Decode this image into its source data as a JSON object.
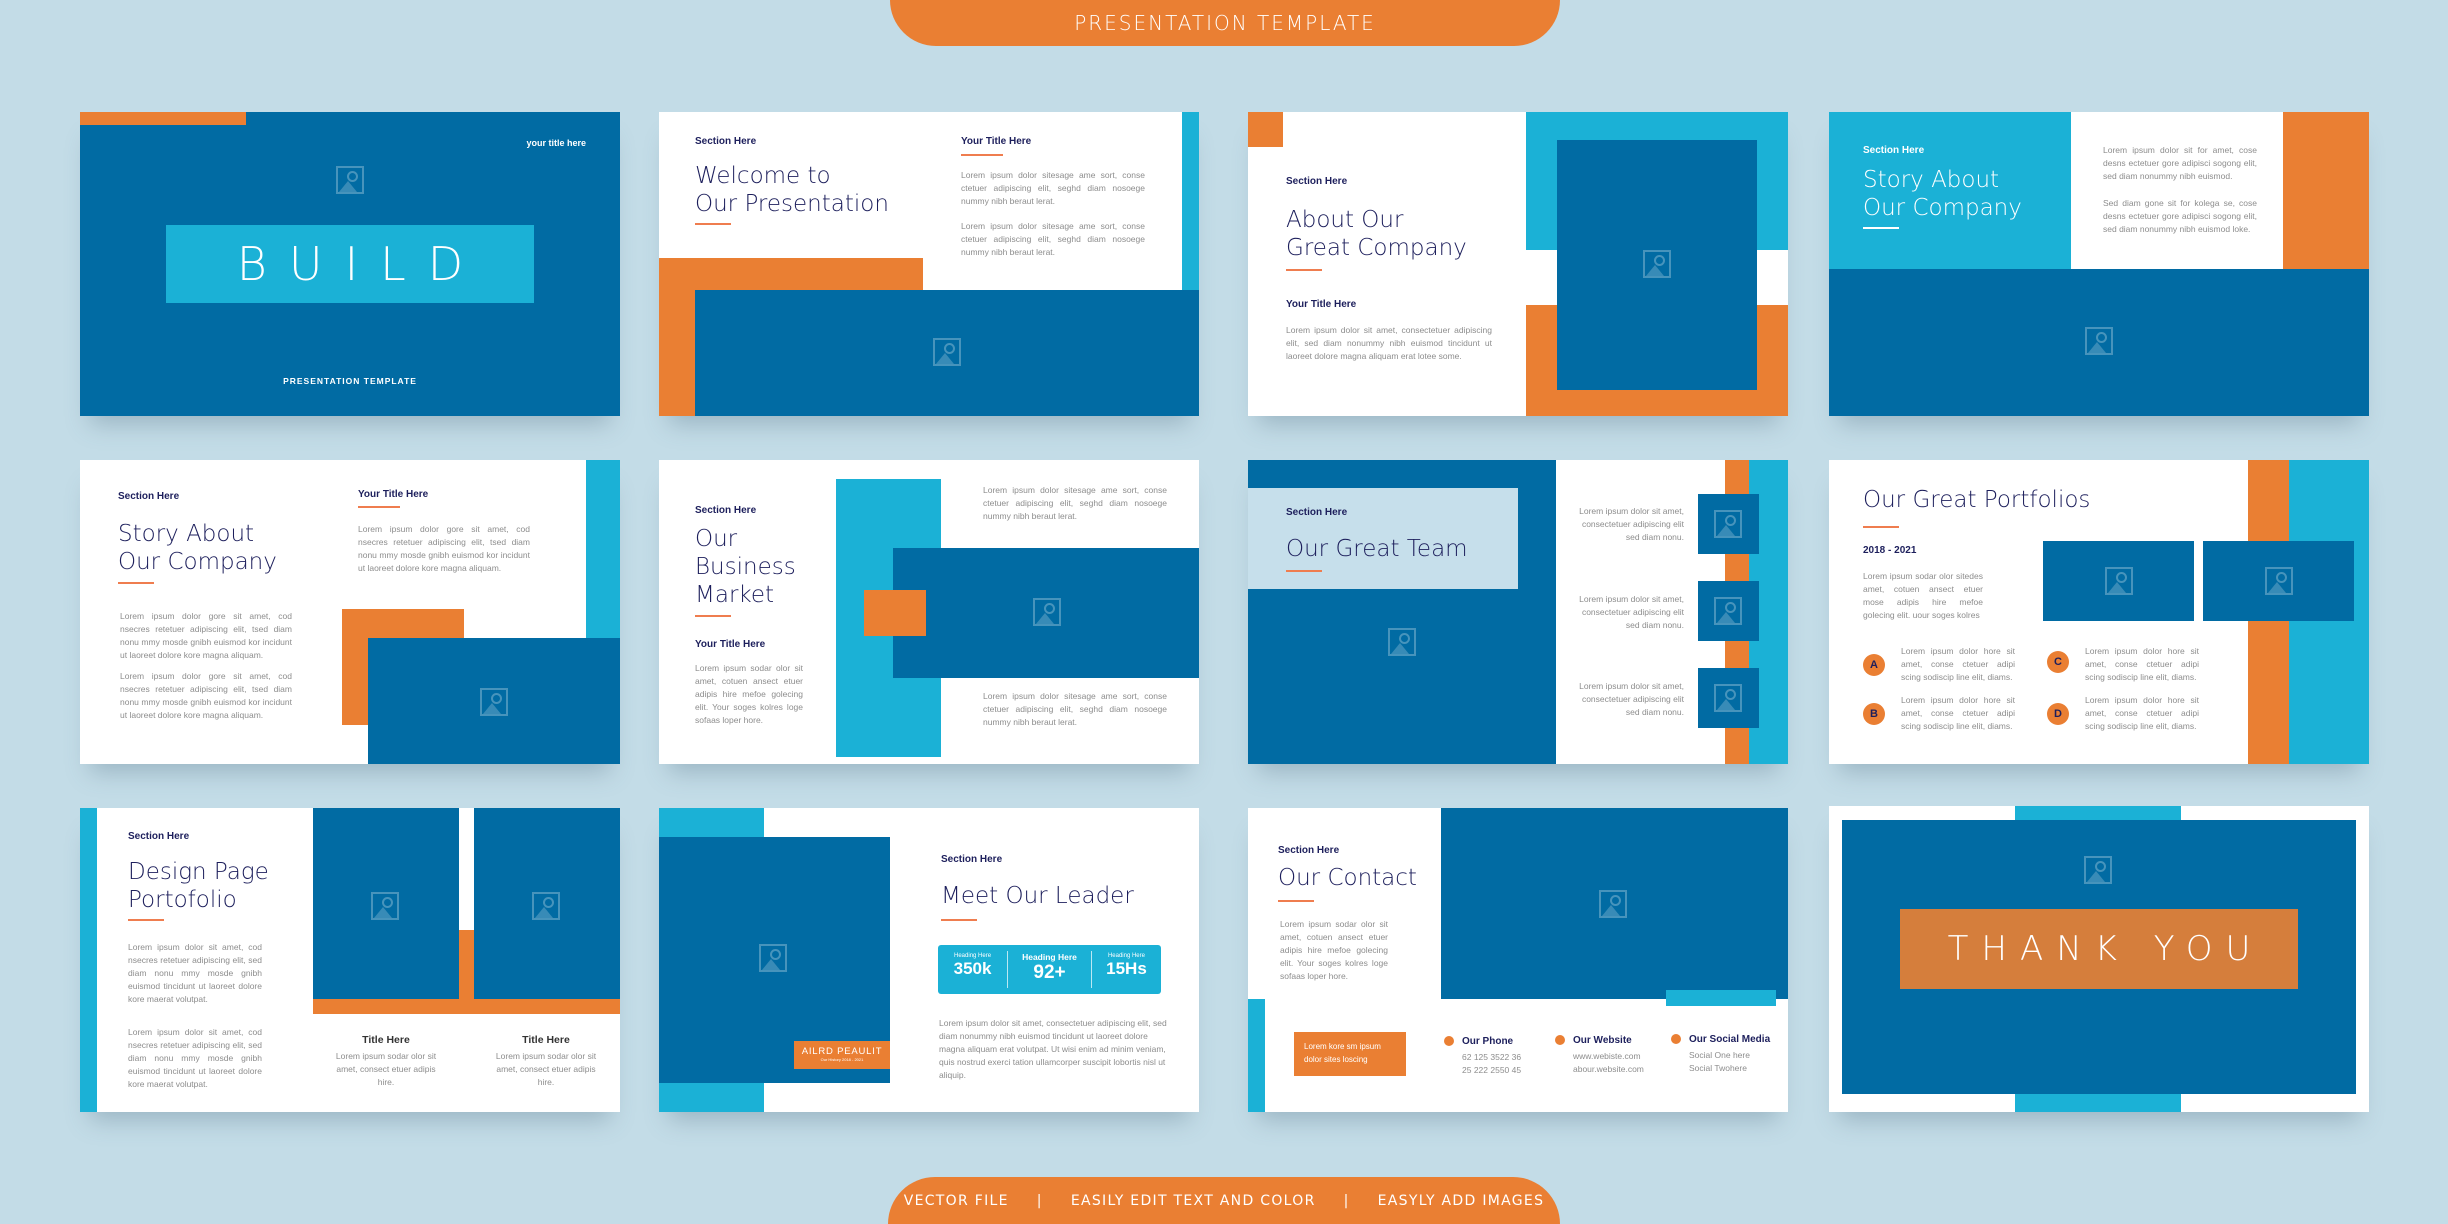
{
  "header_banner": "PRESENTATION TEMPLATE",
  "footer_banner": [
    "VECTOR FILE",
    "|",
    "EASILY EDIT TEXT AND COLOR",
    "|",
    "EASYLY ADD IMAGES"
  ],
  "colors": {
    "dark_blue": "#016ba3",
    "cyan": "#1bb1d6",
    "orange": "#ea7f33",
    "navy_text": "#1d1f5c",
    "background": "#c3dce7"
  },
  "slides": [
    {
      "corner_label": "your title here",
      "title": "BUILD",
      "subtitle": "PRESENTATION TEMPLATE"
    },
    {
      "section": "Section Here",
      "title_1": "Welcome to",
      "title_2": "Our Presentation",
      "subtitle": "Your Title Here",
      "body_1": "Lorem ipsum dolor sitesage ame sort, conse ctetuer adipiscing elit, seghd diam nosoege nummy nibh beraut lerat.",
      "body_2": "Lorem ipsum dolor sitesage ame sort, conse ctetuer adipiscing elit, seghd diam nosoege nummy nibh beraut lerat."
    },
    {
      "section": "Section Here",
      "title_1": "About Our",
      "title_2": "Great Company",
      "subtitle": "Your Title Here",
      "body": "Lorem ipsum dolor sit amet, consectetuer adipiscing elit, sed diam nonummy nibh euismod tincidunt ut laoreet dolore magna aliquam erat lotee some."
    },
    {
      "section": "Section Here",
      "title_1": "Story About",
      "title_2": "Our Company",
      "body_1": "Lorem ipsum dolor sit for amet, cose desns ectetuer gore adipisci sogong elit, sed diam nonummy nibh euismod.",
      "body_2": "Sed diam gone sit for kolega se, cose desns ectetuer gore adipisci sogong elit, sed diam nonummy nibh euismod loke."
    },
    {
      "section": "Section Here",
      "title_1": "Story About",
      "title_2": "Our Company",
      "subtitle": "Your Title Here",
      "body_right": "Lorem ipsum dolor gore sit amet, cod nsecres retetuer adipiscing elit, tsed diam nonu mmy mosde gnibh euismod kor incidunt ut laoreet dolore kore magna aliquam.",
      "body_1": "Lorem ipsum dolor gore sit amet, cod nsecres retetuer adipiscing elit, tsed diam nonu mmy mosde gnibh euismod kor incidunt ut laoreet dolore kore magna aliquam.",
      "body_2": "Lorem ipsum dolor gore sit amet, cod nsecres retetuer adipiscing elit, tsed diam nonu mmy mosde gnibh euismod kor incidunt ut laoreet dolore kore magna aliquam."
    },
    {
      "section": "Section Here",
      "title_1": "Our",
      "title_2": "Business",
      "title_3": "Market",
      "subtitle": "Your Title Here",
      "body": "Lorem ipsum sodar olor sit amet, cotuen ansect etuer adipis hire mefoe golecing elit. Your soges kolres loge sofaas loper hore.",
      "body_top": "Lorem ipsum dolor sitesage ame sort, conse ctetuer adipiscing elit, seghd diam nosoege nummy nibh beraut lerat.",
      "body_bottom": "Lorem ipsum dolor sitesage ame sort, conse ctetuer adipiscing elit, seghd diam nosoege nummy nibh beraut lerat."
    },
    {
      "section": "Section Here",
      "title": "Our Great Team",
      "members": [
        {
          "text": "Lorem ipsum dolor sit amet, consectetuer adipiscing elit sed diam nonu."
        },
        {
          "text": "Lorem ipsum dolor sit amet, consectetuer adipiscing elit sed diam nonu."
        },
        {
          "text": "Lorem ipsum dolor sit amet, consectetuer adipiscing elit sed diam nonu."
        }
      ]
    },
    {
      "title": "Our Great Portfolios",
      "years": "2018 - 2021",
      "body": "Lorem ipsum sodar olor sitedes amet, cotuen ansect etuer mose adipis hire mefoe golecing elit. uour soges kolres",
      "items": [
        {
          "letter": "A",
          "text": "Lorem ipsum dolor hore sit amet, conse ctetuer adipi scing sodiscip line elit, diams."
        },
        {
          "letter": "B",
          "text": "Lorem ipsum dolor hore sit amet, conse ctetuer adipi scing sodiscip line elit, diams."
        },
        {
          "letter": "C",
          "text": "Lorem ipsum dolor hore sit amet, conse ctetuer adipi scing sodiscip line elit, diams."
        },
        {
          "letter": "D",
          "text": "Lorem ipsum dolor hore sit amet, conse ctetuer adipi scing sodiscip line elit, diams."
        }
      ]
    },
    {
      "section": "Section Here",
      "title_1": "Design Page",
      "title_2": "Portofolio",
      "body_1": "Lorem ipsum dolor sit amet, cod nsecres retetuer adipiscing elit, sed diam nonu mmy mosde gnibh euismod tincidunt ut laoreet dolore kore maerat volutpat.",
      "body_2": "Lorem ipsum dolor sit amet, cod nsecres retetuer adipiscing elit, sed diam nonu mmy mosde gnibh euismod tincidunt ut laoreet dolore kore maerat volutpat.",
      "cards": [
        {
          "title": "Title Here",
          "text": "Lorem ipsum sodar olor sit amet, consect etuer adipis hire."
        },
        {
          "title": "Title Here",
          "text": "Lorem ipsum sodar olor sit amet, consect etuer adipis hire."
        }
      ]
    },
    {
      "section": "Section Here",
      "title": "Meet Our Leader",
      "name": "AILRD PEAULIT",
      "name_sub": "Our History 2018 - 2021",
      "stats": [
        {
          "label": "Heading Here",
          "value": "350k"
        },
        {
          "label": "Heading Here",
          "value": "92+"
        },
        {
          "label": "Heading Here",
          "value": "15Hs"
        }
      ],
      "body": "Lorem ipsum dolor sit amet, consectetuer adipiscing elit, sed diam nonummy nibh euismod tincidunt ut laoreet dolore magna aliquam erat volutpat. Ut wisi enim ad minim veniam, quis nostrud exerci tation ullamcorper suscipit lobortis nisl ut aliquip."
    },
    {
      "section": "Section Here",
      "title": "Our Contact",
      "body": "Lorem ipsum sodar olor sit amet, cotuen ansect etuer adipis hire mefoe golecing elit. Your soges kolres loge sofaas loper hore.",
      "callout": "Lorem kore sm ipsum dolor sites loscing",
      "contacts": [
        {
          "label": "Our Phone",
          "line_1": "62 125 3522 36",
          "line_2": "25 222 2550 45"
        },
        {
          "label": "Our Website",
          "line_1": "www.webiste.com",
          "line_2": "abour.website.com"
        },
        {
          "label": "Our Social Media",
          "line_1": "Social One here",
          "line_2": "Social Twohere"
        }
      ]
    },
    {
      "title": "THANK YOU"
    }
  ]
}
